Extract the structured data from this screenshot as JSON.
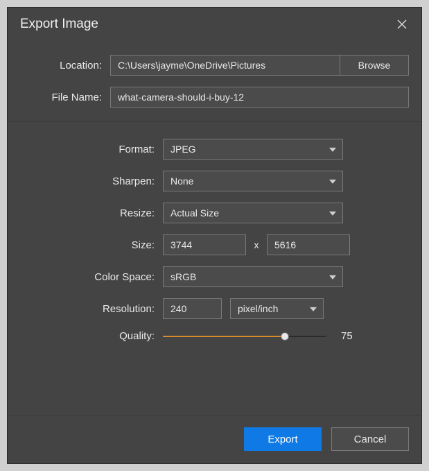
{
  "dialog": {
    "title": "Export Image"
  },
  "top": {
    "locationLabel": "Location:",
    "locationValue": "C:\\Users\\jayme\\OneDrive\\Pictures",
    "browseLabel": "Browse",
    "fileNameLabel": "File Name:",
    "fileNameValue": "what-camera-should-i-buy-12"
  },
  "mid": {
    "formatLabel": "Format:",
    "formatValue": "JPEG",
    "sharpenLabel": "Sharpen:",
    "sharpenValue": "None",
    "resizeLabel": "Resize:",
    "resizeValue": "Actual Size",
    "sizeLabel": "Size:",
    "sizeW": "3744",
    "sizeX": "x",
    "sizeH": "5616",
    "colorSpaceLabel": "Color Space:",
    "colorSpaceValue": "sRGB",
    "resolutionLabel": "Resolution:",
    "resolutionValue": "240",
    "resolutionUnit": "pixel/inch",
    "qualityLabel": "Quality:",
    "qualityValue": "75",
    "qualityPercent": 75
  },
  "footer": {
    "export": "Export",
    "cancel": "Cancel"
  }
}
